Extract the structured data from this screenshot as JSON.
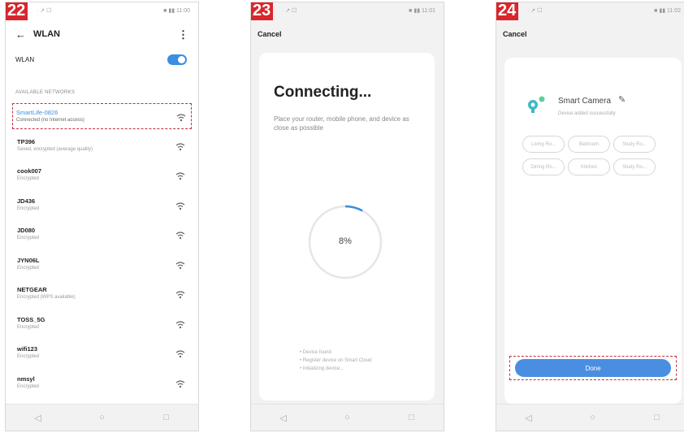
{
  "panels": {
    "p1": {
      "step": "22",
      "status_left": "· ↗ ☐",
      "status_right": "■ ▮▮ 11:00",
      "title": "WLAN",
      "back_glyph": "←",
      "more_glyph": "⋮",
      "wlan_label": "WLAN",
      "wlan_on": true,
      "section_label": "AVAILABLE NETWORKS",
      "networks": [
        {
          "name": "SmartLife-0826",
          "sub": "Connected (no Internet access)",
          "highlight": true
        },
        {
          "name": "TP396",
          "sub": "Saved, encrypted (average quality)"
        },
        {
          "name": "cook007",
          "sub": "Encrypted"
        },
        {
          "name": "JD436",
          "sub": "Encrypted"
        },
        {
          "name": "JD080",
          "sub": "Encrypted"
        },
        {
          "name": "JYN06L",
          "sub": "Encrypted"
        },
        {
          "name": "NETGEAR",
          "sub": "Encrypted (WPS available)"
        },
        {
          "name": "TOSS_5G",
          "sub": "Encrypted"
        },
        {
          "name": "wifi123",
          "sub": "Encrypted"
        },
        {
          "name": "nmsyl",
          "sub": "Encrypted"
        }
      ]
    },
    "p2": {
      "step": "23",
      "status_left": "· ↗ ☐",
      "status_right": "■ ▮▮ 11:01",
      "cancel": "Cancel",
      "title": "Connecting...",
      "desc": "Place your router, mobile phone, and device as close as possible",
      "progress_text": "8%",
      "progress": 0.08,
      "steps": [
        "• Device found",
        "• Register device on Smart Cloud",
        "• Initializing device..."
      ]
    },
    "p3": {
      "step": "24",
      "status_left": "· ↗ ☐",
      "status_right": "■ ▮▮ 11:02",
      "cancel": "Cancel",
      "device_name": "Smart Camera",
      "device_sub": "Device added successfully",
      "edit_glyph": "✎",
      "rooms": [
        "Living Ro...",
        "Bedroom",
        "Study Ro...",
        "Dining Ro...",
        "Kitchen",
        "Study Ro..."
      ],
      "done": "Done"
    }
  },
  "nav": {
    "back": "◁",
    "home": "○",
    "recent": "□"
  },
  "colors": {
    "accent": "#3b8ee0",
    "badge": "#d8262c",
    "highlight_border": "#c0303a"
  }
}
